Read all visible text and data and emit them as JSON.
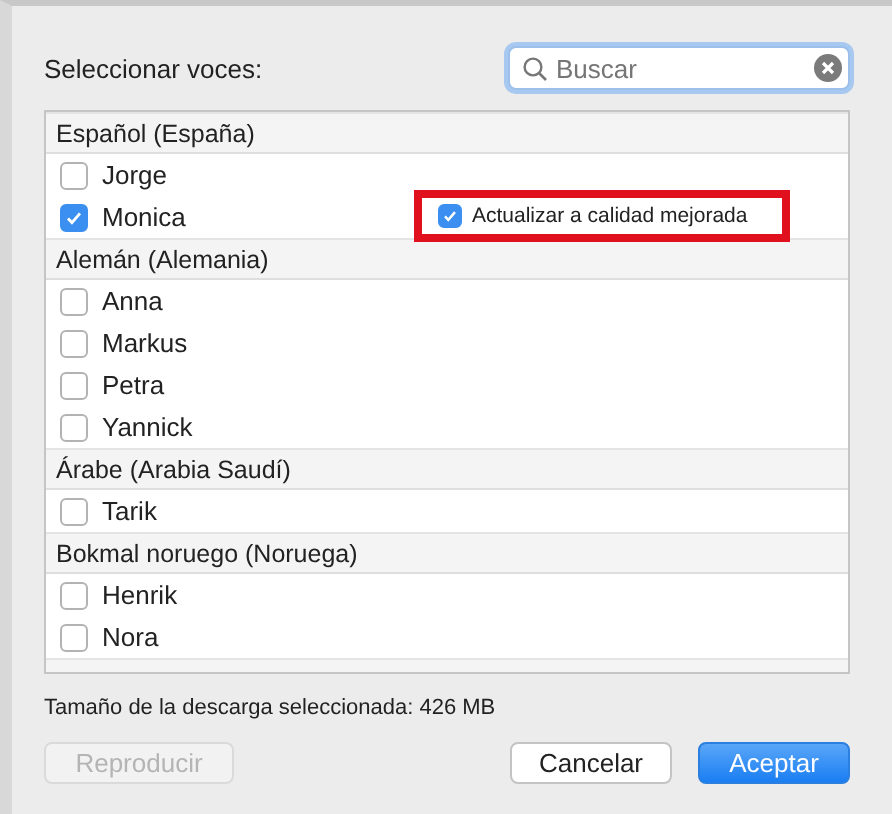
{
  "label": "Seleccionar voces:",
  "search": {
    "placeholder": "Buscar"
  },
  "groups": [
    {
      "name": "Español (España)",
      "voices": [
        {
          "name": "Jorge",
          "checked": false
        },
        {
          "name": "Monica",
          "checked": true,
          "upgrade": {
            "label": "Actualizar a calidad mejorada",
            "checked": true,
            "highlighted": true
          }
        }
      ]
    },
    {
      "name": "Alemán (Alemania)",
      "voices": [
        {
          "name": "Anna",
          "checked": false
        },
        {
          "name": "Markus",
          "checked": false
        },
        {
          "name": "Petra",
          "checked": false
        },
        {
          "name": "Yannick",
          "checked": false
        }
      ]
    },
    {
      "name": "Árabe (Arabia Saudí)",
      "voices": [
        {
          "name": "Tarik",
          "checked": false
        }
      ]
    },
    {
      "name": "Bokmal noruego (Noruega)",
      "voices": [
        {
          "name": "Henrik",
          "checked": false
        },
        {
          "name": "Nora",
          "checked": false
        }
      ]
    }
  ],
  "download_size": "Tamaño de la descarga seleccionada: 426 MB",
  "buttons": [
    {
      "label": "Reproducir",
      "kind": "secondary",
      "disabled": true
    },
    {
      "label": "Cancelar",
      "kind": "secondary",
      "disabled": false
    },
    {
      "label": "Aceptar",
      "kind": "primary",
      "disabled": false
    }
  ]
}
